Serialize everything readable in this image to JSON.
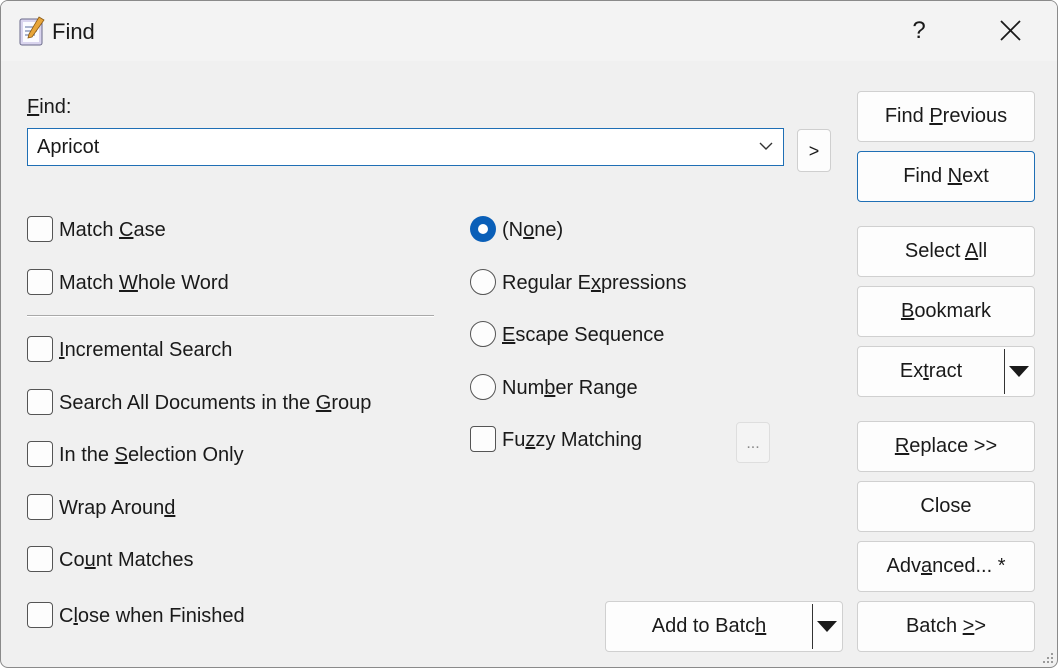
{
  "window": {
    "title": "Find",
    "help_label": "?"
  },
  "find": {
    "label_u": "F",
    "label_rest": "ind:",
    "value": "Apricot",
    "arrow_button": ">"
  },
  "left_options": [
    {
      "pre": "Match ",
      "u": "C",
      "post": "ase",
      "checked": false
    },
    {
      "pre": "Match ",
      "u": "W",
      "post": "hole Word",
      "checked": false
    },
    {
      "pre": "",
      "u": "I",
      "post": "ncremental Search",
      "checked": false
    },
    {
      "pre": "Search All Documents in the ",
      "u": "G",
      "post": "roup",
      "checked": false
    },
    {
      "pre": "In the ",
      "u": "S",
      "post": "election Only",
      "checked": false
    },
    {
      "pre": "Wrap Aroun",
      "u": "d",
      "post": "",
      "checked": false
    },
    {
      "pre": "Co",
      "u": "u",
      "post": "nt Matches",
      "checked": false
    },
    {
      "pre": "C",
      "u": "l",
      "post": "ose when Finished",
      "checked": false
    }
  ],
  "mode_options": [
    {
      "pre": "(N",
      "u": "o",
      "post": "ne)",
      "selected": true
    },
    {
      "pre": "Regular E",
      "u": "x",
      "post": "pressions",
      "selected": false
    },
    {
      "pre": "",
      "u": "E",
      "post": "scape Sequence",
      "selected": false
    },
    {
      "pre": "Num",
      "u": "b",
      "post": "er Range",
      "selected": false
    }
  ],
  "fuzzy": {
    "pre": "Fu",
    "u": "z",
    "post": "zy Matching",
    "checked": false,
    "settings_label": "..."
  },
  "buttons": {
    "find_previous": {
      "pre": "Find ",
      "u": "P",
      "post": "revious"
    },
    "find_next": {
      "pre": "Find ",
      "u": "N",
      "post": "ext"
    },
    "select_all": {
      "pre": "Select ",
      "u": "A",
      "post": "ll"
    },
    "bookmark": {
      "pre": "",
      "u": "B",
      "post": "ookmark"
    },
    "extract": {
      "pre": "Ex",
      "u": "t",
      "post": "ract"
    },
    "replace": {
      "pre": "",
      "u": "R",
      "post": "eplace >>"
    },
    "close": {
      "pre": "Close",
      "u": "",
      "post": ""
    },
    "advanced": {
      "pre": "Adv",
      "u": "a",
      "post": "nced... *"
    },
    "batch": {
      "pre": "Batch ",
      "u": ">",
      "post": ">"
    },
    "add_to_batch": {
      "pre": "Add to Batc",
      "u": "h",
      "post": ""
    }
  },
  "colors": {
    "accent": "#0a5fb8",
    "focus_border": "#1f6fb5",
    "window_bg": "#f0f0f0"
  }
}
